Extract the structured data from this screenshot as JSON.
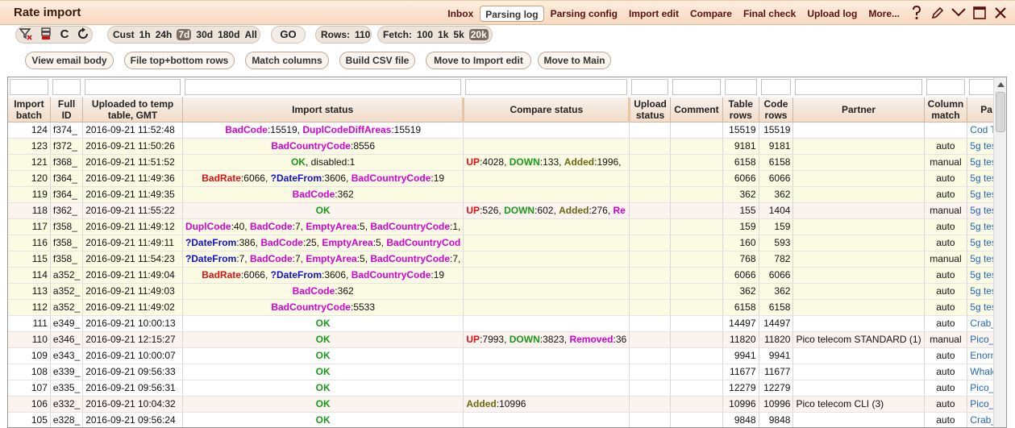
{
  "app": {
    "title": "Rate import"
  },
  "menu": [
    "Inbox",
    "Parsing log",
    "Parsing config",
    "Import edit",
    "Compare",
    "Final check",
    "Upload log",
    "More..."
  ],
  "menu_active": "Parsing log",
  "title_icons": [
    "help-icon",
    "edit-pencil-icon",
    "collapse-chevron-icon",
    "maximize-icon",
    "close-icon"
  ],
  "toolbar": {
    "period_options": [
      "Cust",
      "1h",
      "24h",
      "7d",
      "30d",
      "180d",
      "All"
    ],
    "period_selected": "7d",
    "go_label": "GO",
    "rows_label": "Rows:",
    "rows_value": "110",
    "fetch_label": "Fetch:",
    "fetch_options": [
      "100",
      "1k",
      "5k",
      "20k"
    ],
    "fetch_selected": "20k"
  },
  "actions": [
    "View email body",
    "File top+bottom rows",
    "Match columns",
    "Build CSV file",
    "Move to Import edit",
    "Move to Main"
  ],
  "columns": [
    "Import batch",
    "Full ID",
    "Uploaded to temp table, GMT",
    "Import status",
    "Compare status",
    "Upload status",
    "Comment",
    "Table rows",
    "Code rows",
    "Partner",
    "Column match",
    "Pa"
  ],
  "colors": {
    "red": "#dd1111",
    "magenta": "#d400d4",
    "blue": "#1010d0",
    "green": "#1a9a1a",
    "olive": "#6a6a10",
    "row_yellow": "#fbfbe4",
    "row_pink": "#fbf3ee",
    "header": "#f2dcc8",
    "link": "#2266bb"
  },
  "rows": [
    {
      "batch": "124",
      "full_id": "f374_",
      "uploaded": "2016-09-21 11:52:48",
      "import": [
        {
          "t": "BadCode",
          "c": "mag"
        },
        {
          "t": ":15519, "
        },
        {
          "t": "DuplCodeDiffAreas",
          "c": "mag"
        },
        {
          "t": ":15519"
        }
      ],
      "import_align": "c",
      "compare": [],
      "upload": "",
      "comment": "",
      "table_rows": "15519",
      "code_rows": "15519",
      "partner": "",
      "match": "",
      "pa": "Cod T",
      "bg": "white"
    },
    {
      "batch": "123",
      "full_id": "f372_",
      "uploaded": "2016-09-21 11:50:26",
      "import": [
        {
          "t": "BadCountryCode",
          "c": "mag"
        },
        {
          "t": ":8556"
        }
      ],
      "import_align": "c",
      "compare": [],
      "upload": "",
      "comment": "",
      "table_rows": "9181",
      "code_rows": "9181",
      "partner": "",
      "match": "auto",
      "pa": "5g tes",
      "bg": "yellow"
    },
    {
      "batch": "121",
      "full_id": "f368_",
      "uploaded": "2016-09-21 11:51:52",
      "import": [
        {
          "t": "OK",
          "c": "green"
        },
        {
          "t": ", disabled:1"
        }
      ],
      "import_align": "c",
      "compare": [
        {
          "t": "UP",
          "c": "red"
        },
        {
          "t": ":4028, "
        },
        {
          "t": "DOWN",
          "c": "green"
        },
        {
          "t": ":133, "
        },
        {
          "t": "Added",
          "c": "olive"
        },
        {
          "t": ":1996,"
        }
      ],
      "upload": "",
      "comment": "",
      "table_rows": "6158",
      "code_rows": "6158",
      "partner": "",
      "match": "manual",
      "pa": "5g tes",
      "bg": "yellow"
    },
    {
      "batch": "120",
      "full_id": "f364_",
      "uploaded": "2016-09-21 11:49:36",
      "import": [
        {
          "t": "BadRate",
          "c": "red"
        },
        {
          "t": ":6066, "
        },
        {
          "t": "?DateFrom",
          "c": "blue"
        },
        {
          "t": ":3606, "
        },
        {
          "t": "BadCountryCode",
          "c": "mag"
        },
        {
          "t": ":19"
        }
      ],
      "import_align": "c",
      "compare": [],
      "upload": "",
      "comment": "",
      "table_rows": "6066",
      "code_rows": "6066",
      "partner": "",
      "match": "auto",
      "pa": "5g tes",
      "bg": "yellow"
    },
    {
      "batch": "119",
      "full_id": "f364_",
      "uploaded": "2016-09-21 11:49:35",
      "import": [
        {
          "t": "BadCode",
          "c": "mag"
        },
        {
          "t": ":362"
        }
      ],
      "import_align": "c",
      "compare": [],
      "upload": "",
      "comment": "",
      "table_rows": "362",
      "code_rows": "362",
      "partner": "",
      "match": "auto",
      "pa": "5g tes",
      "bg": "yellow"
    },
    {
      "batch": "118",
      "full_id": "f362_",
      "uploaded": "2016-09-21 11:55:22",
      "import": [
        {
          "t": "OK",
          "c": "green"
        }
      ],
      "import_align": "c",
      "compare": [
        {
          "t": "UP",
          "c": "red"
        },
        {
          "t": ":526, "
        },
        {
          "t": "DOWN",
          "c": "green"
        },
        {
          "t": ":602, "
        },
        {
          "t": "Added",
          "c": "olive"
        },
        {
          "t": ":276, "
        },
        {
          "t": "Re",
          "c": "mag"
        }
      ],
      "upload": "",
      "comment": "",
      "table_rows": "155",
      "code_rows": "1404",
      "partner": "",
      "match": "manual",
      "pa": "5g tes",
      "bg": "pink"
    },
    {
      "batch": "117",
      "full_id": "f358_",
      "uploaded": "2016-09-21 11:49:12",
      "import": [
        {
          "t": "DuplCode",
          "c": "mag"
        },
        {
          "t": ":40, "
        },
        {
          "t": "BadCode",
          "c": "mag"
        },
        {
          "t": ":7, "
        },
        {
          "t": "EmptyArea",
          "c": "mag"
        },
        {
          "t": ":5, "
        },
        {
          "t": "BadCountryCode",
          "c": "mag"
        },
        {
          "t": ":1,"
        }
      ],
      "import_align": "l",
      "compare": [],
      "upload": "",
      "comment": "",
      "table_rows": "159",
      "code_rows": "159",
      "partner": "",
      "match": "auto",
      "pa": "5g tes",
      "bg": "yellow"
    },
    {
      "batch": "116",
      "full_id": "f358_",
      "uploaded": "2016-09-21 11:49:11",
      "import": [
        {
          "t": "?DateFrom",
          "c": "blue"
        },
        {
          "t": ":386, "
        },
        {
          "t": "BadCode",
          "c": "mag"
        },
        {
          "t": ":25, "
        },
        {
          "t": "EmptyArea",
          "c": "mag"
        },
        {
          "t": ":5, "
        },
        {
          "t": "BadCountryCod",
          "c": "mag"
        }
      ],
      "import_align": "l",
      "compare": [],
      "upload": "",
      "comment": "",
      "table_rows": "160",
      "code_rows": "593",
      "partner": "",
      "match": "auto",
      "pa": "5g tes",
      "bg": "yellow"
    },
    {
      "batch": "115",
      "full_id": "f358_",
      "uploaded": "2016-09-21 11:54:23",
      "import": [
        {
          "t": "?DateFrom",
          "c": "blue"
        },
        {
          "t": ":7, "
        },
        {
          "t": "BadCode",
          "c": "mag"
        },
        {
          "t": ":7, "
        },
        {
          "t": "EmptyArea",
          "c": "mag"
        },
        {
          "t": ":5, "
        },
        {
          "t": "BadCountryCode",
          "c": "mag"
        },
        {
          "t": ":7,"
        }
      ],
      "import_align": "l",
      "compare": [],
      "upload": "",
      "comment": "",
      "table_rows": "768",
      "code_rows": "782",
      "partner": "",
      "match": "manual",
      "pa": "5g tes",
      "bg": "yellow"
    },
    {
      "batch": "114",
      "full_id": "a352_",
      "uploaded": "2016-09-21 11:49:04",
      "import": [
        {
          "t": "BadRate",
          "c": "red"
        },
        {
          "t": ":6066, "
        },
        {
          "t": "?DateFrom",
          "c": "blue"
        },
        {
          "t": ":3606, "
        },
        {
          "t": "BadCountryCode",
          "c": "mag"
        },
        {
          "t": ":19"
        }
      ],
      "import_align": "c",
      "compare": [],
      "upload": "",
      "comment": "",
      "table_rows": "6066",
      "code_rows": "6066",
      "partner": "",
      "match": "auto",
      "pa": "5g tes",
      "bg": "yellow"
    },
    {
      "batch": "113",
      "full_id": "a352_",
      "uploaded": "2016-09-21 11:49:03",
      "import": [
        {
          "t": "BadCode",
          "c": "mag"
        },
        {
          "t": ":362"
        }
      ],
      "import_align": "c",
      "compare": [],
      "upload": "",
      "comment": "",
      "table_rows": "362",
      "code_rows": "362",
      "partner": "",
      "match": "auto",
      "pa": "5g tes",
      "bg": "yellow"
    },
    {
      "batch": "112",
      "full_id": "a352_",
      "uploaded": "2016-09-21 11:49:02",
      "import": [
        {
          "t": "BadCountryCode",
          "c": "mag"
        },
        {
          "t": ":5533"
        }
      ],
      "import_align": "c",
      "compare": [],
      "upload": "",
      "comment": "",
      "table_rows": "6158",
      "code_rows": "6158",
      "partner": "",
      "match": "auto",
      "pa": "5g tes",
      "bg": "yellow"
    },
    {
      "batch": "111",
      "full_id": "e349_",
      "uploaded": "2016-09-21 10:00:13",
      "import": [
        {
          "t": "OK",
          "c": "green"
        }
      ],
      "import_align": "c",
      "compare": [],
      "upload": "",
      "comment": "",
      "table_rows": "14497",
      "code_rows": "14497",
      "partner": "",
      "match": "auto",
      "pa": "Crab_",
      "bg": "white"
    },
    {
      "batch": "110",
      "full_id": "e346_",
      "uploaded": "2016-09-21 12:15:27",
      "import": [
        {
          "t": "OK",
          "c": "green"
        }
      ],
      "import_align": "c",
      "compare": [
        {
          "t": "UP",
          "c": "red"
        },
        {
          "t": ":7993, "
        },
        {
          "t": "DOWN",
          "c": "green"
        },
        {
          "t": ":3823, "
        },
        {
          "t": "Removed",
          "c": "mag"
        },
        {
          "t": ":36"
        }
      ],
      "upload": "",
      "comment": "",
      "table_rows": "11820",
      "code_rows": "11820",
      "partner": "Pico telecom STANDARD (1)",
      "match": "manual",
      "pa": "Pico_",
      "bg": "pink"
    },
    {
      "batch": "109",
      "full_id": "e343_",
      "uploaded": "2016-09-21 10:00:07",
      "import": [
        {
          "t": "OK",
          "c": "green"
        }
      ],
      "import_align": "c",
      "compare": [],
      "upload": "",
      "comment": "",
      "table_rows": "9941",
      "code_rows": "9941",
      "partner": "",
      "match": "auto",
      "pa": "Enorm",
      "bg": "white"
    },
    {
      "batch": "108",
      "full_id": "e339_",
      "uploaded": "2016-09-21 09:56:33",
      "import": [
        {
          "t": "OK",
          "c": "green"
        }
      ],
      "import_align": "c",
      "compare": [],
      "upload": "",
      "comment": "",
      "table_rows": "11677",
      "code_rows": "11677",
      "partner": "",
      "match": "auto",
      "pa": "Whale",
      "bg": "white"
    },
    {
      "batch": "107",
      "full_id": "e335_",
      "uploaded": "2016-09-21 09:56:31",
      "import": [
        {
          "t": "OK",
          "c": "green"
        }
      ],
      "import_align": "c",
      "compare": [],
      "upload": "",
      "comment": "",
      "table_rows": "12279",
      "code_rows": "12279",
      "partner": "",
      "match": "auto",
      "pa": "Pico_",
      "bg": "white"
    },
    {
      "batch": "106",
      "full_id": "e332_",
      "uploaded": "2016-09-21 10:04:32",
      "import": [
        {
          "t": "OK",
          "c": "green"
        }
      ],
      "import_align": "c",
      "compare": [
        {
          "t": "Added",
          "c": "olive"
        },
        {
          "t": ":10996"
        }
      ],
      "upload": "",
      "comment": "",
      "table_rows": "10996",
      "code_rows": "10996",
      "partner": "Pico telecom CLI (3)",
      "match": "auto",
      "pa": "Pico_",
      "bg": "pink"
    },
    {
      "batch": "105",
      "full_id": "e328_",
      "uploaded": "2016-09-21 09:56:24",
      "import": [
        {
          "t": "OK",
          "c": "green"
        }
      ],
      "import_align": "c",
      "compare": [],
      "upload": "",
      "comment": "",
      "table_rows": "9848",
      "code_rows": "9848",
      "partner": "",
      "match": "auto",
      "pa": "Crab_",
      "bg": "white"
    }
  ]
}
